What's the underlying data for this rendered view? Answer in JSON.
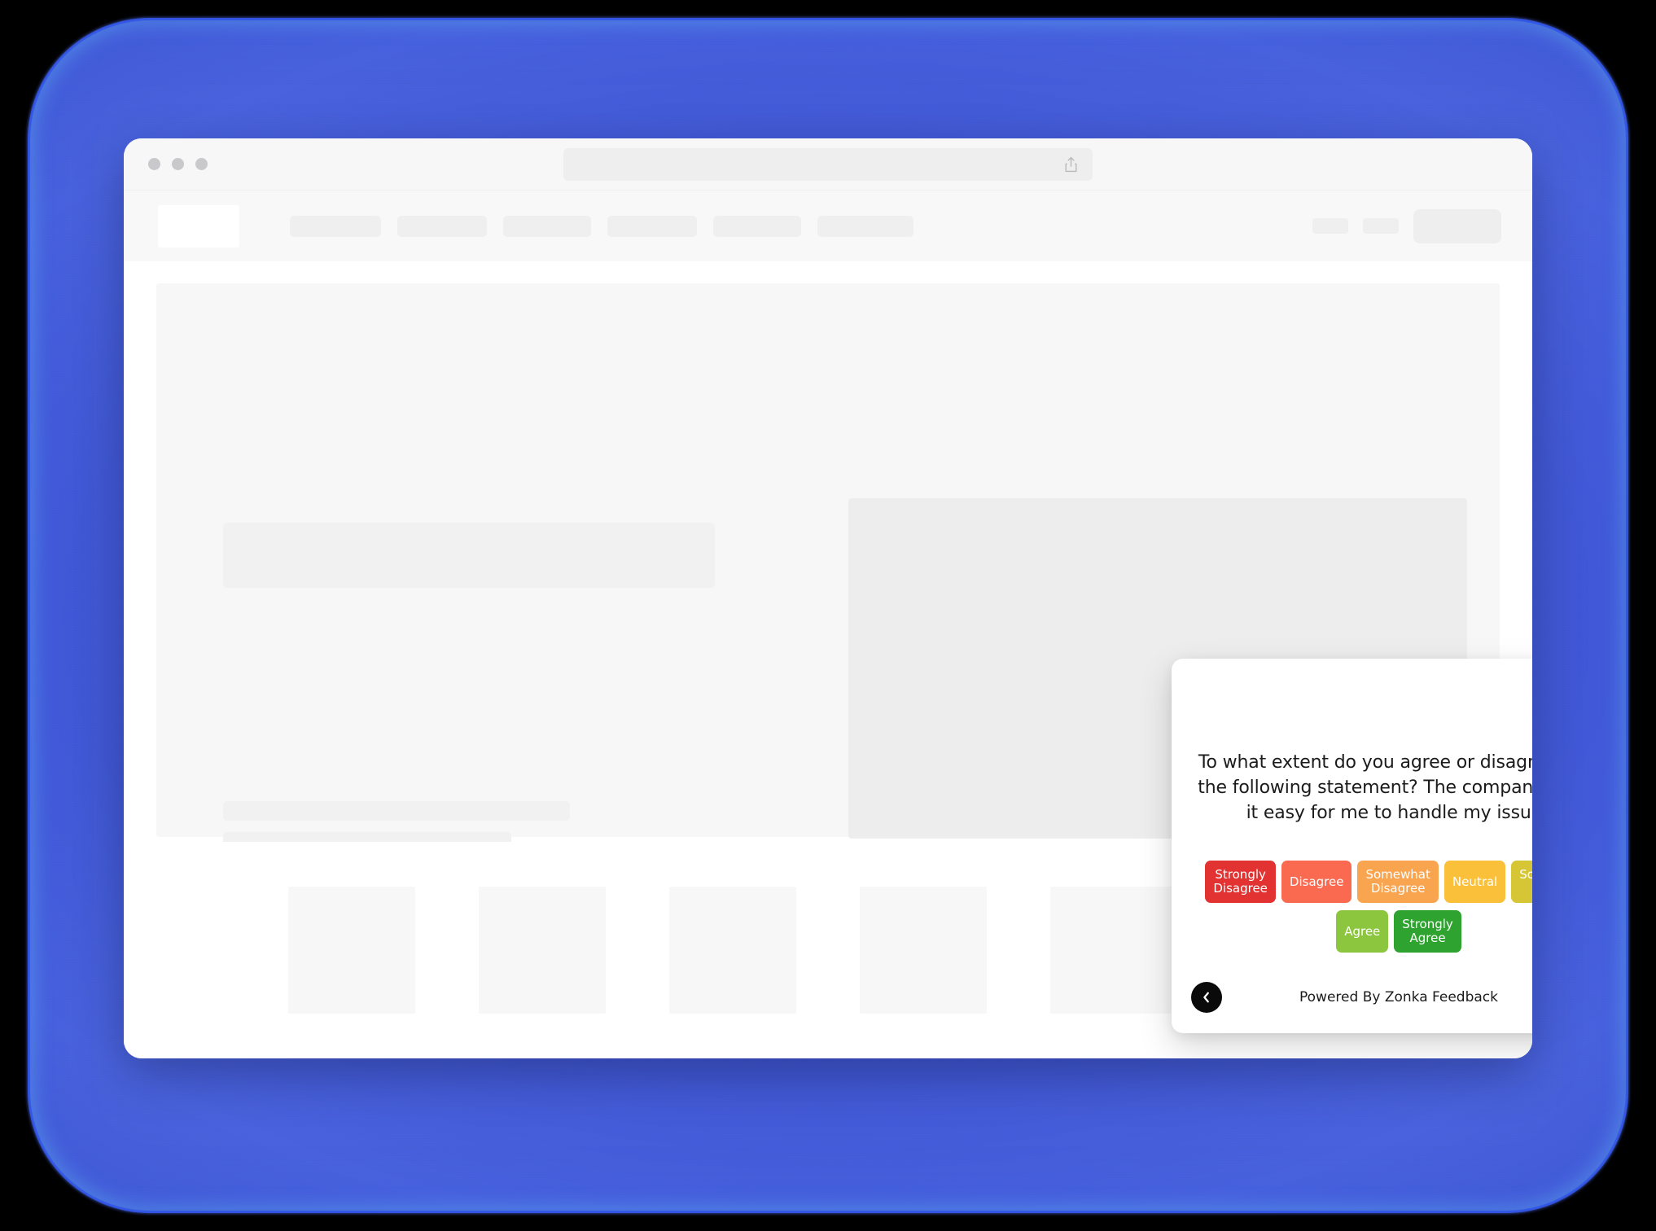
{
  "backdrop": {
    "color": "#4259d6",
    "outer_color": "#000000"
  },
  "browser": {
    "traffic_lights": [
      "dot-1",
      "dot-2",
      "dot-3"
    ],
    "url_value": "",
    "url_placeholder": "",
    "share_icon": "share-icon"
  },
  "site_nav": {
    "logo": "logo-placeholder",
    "links": [
      {
        "name": "nav-link-1"
      },
      {
        "name": "nav-link-2"
      },
      {
        "name": "nav-link-3"
      },
      {
        "name": "nav-link-4"
      },
      {
        "name": "nav-link-5"
      },
      {
        "name": "nav-link-6"
      }
    ],
    "pills": [
      "nav-pill-1",
      "nav-pill-2"
    ],
    "cta": "nav-cta-button"
  },
  "page": {
    "hero_panel": "hero-placeholder-panel",
    "skeleton": {
      "title": "title-placeholder",
      "line_1": "text-line-placeholder",
      "line_2": "text-line-placeholder",
      "field": "input-placeholder",
      "field_button": "submit-button-placeholder"
    },
    "media_panel": "media-placeholder-panel",
    "logo_cards": [
      "logo-card-1",
      "logo-card-2",
      "logo-card-3",
      "logo-card-4",
      "logo-card-5",
      "logo-card-6"
    ]
  },
  "survey": {
    "close_label": "close-icon",
    "question": "To what extent do you agree or disagree with the following statement? The company made it easy for me to handle my issues",
    "scale": {
      "row_1": [
        {
          "label": "Strongly\nDisagree",
          "color": "#e23232"
        },
        {
          "label": "Disagree",
          "color": "#f96a51"
        },
        {
          "label": "Somewhat\nDisagree",
          "color": "#f9a44f"
        },
        {
          "label": "Neutral",
          "color": "#fbc03a"
        },
        {
          "label": "Somewhat\nAgree",
          "color": "#d6c535"
        }
      ],
      "row_2": [
        {
          "label": "Agree",
          "color": "#8cc63e"
        },
        {
          "label": "Strongly\nAgree",
          "color": "#2fa32f"
        }
      ]
    },
    "footer": {
      "prev_label": "chevron-left-icon",
      "powered_by": "Powered By Zonka Feedback",
      "next_label": "chevron-right-icon"
    }
  }
}
